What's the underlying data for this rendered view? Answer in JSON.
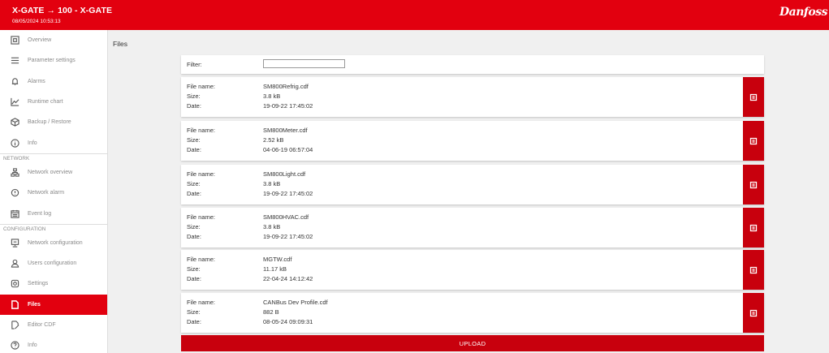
{
  "header": {
    "title": "X-GATE → 100 - X-GATE",
    "timestamp": "08/05/2024 10:53:13",
    "logo_text": "Danfoss",
    "brand_color": "#e2000f"
  },
  "sidebar": {
    "items_top": [
      {
        "label": "Overview",
        "icon": "overview-icon"
      },
      {
        "label": "Parameter settings",
        "icon": "list-icon"
      },
      {
        "label": "Alarms",
        "icon": "bell-icon"
      },
      {
        "label": "Runtime chart",
        "icon": "chart-icon"
      },
      {
        "label": "Backup / Restore",
        "icon": "box-icon"
      },
      {
        "label": "Info",
        "icon": "info-icon"
      }
    ],
    "section_network": "NETWORK",
    "items_network": [
      {
        "label": "Network overview",
        "icon": "network-icon"
      },
      {
        "label": "Network alarm",
        "icon": "alarm-icon"
      },
      {
        "label": "Event log",
        "icon": "calendar-icon"
      }
    ],
    "section_configuration": "CONFIGURATION",
    "items_configuration": [
      {
        "label": "Network configuration",
        "icon": "monitor-icon"
      },
      {
        "label": "Users configuration",
        "icon": "user-icon"
      },
      {
        "label": "Settings",
        "icon": "gear-icon"
      },
      {
        "label": "Files",
        "icon": "file-icon",
        "active": true
      },
      {
        "label": "Editor CDF",
        "icon": "edit-file-icon"
      },
      {
        "label": "Info",
        "icon": "help-icon"
      }
    ]
  },
  "main": {
    "title": "Files",
    "filter": {
      "label": "Filter:",
      "value": "",
      "placeholder": ""
    },
    "field_labels": {
      "name": "File name:",
      "size": "Size:",
      "date": "Date:"
    },
    "files": [
      {
        "name": "SM800Refrig.cdf",
        "size": "3.8 kB",
        "date": "19-09-22 17:45:02"
      },
      {
        "name": "SM800Meter.cdf",
        "size": "2.52 kB",
        "date": "04-06-19 06:57:04"
      },
      {
        "name": "SM800Light.cdf",
        "size": "3.8 kB",
        "date": "19-09-22 17:45:02"
      },
      {
        "name": "SM800HVAC.cdf",
        "size": "3.8 kB",
        "date": "19-09-22 17:45:02"
      },
      {
        "name": "MGTW.cdf",
        "size": "11.17 kB",
        "date": "22-04-24 14:12:42"
      },
      {
        "name": "CANBus Dev Profile.cdf",
        "size": "882 B",
        "date": "08-05-24 09:09:31"
      }
    ],
    "upload_label": "UPLOAD"
  }
}
